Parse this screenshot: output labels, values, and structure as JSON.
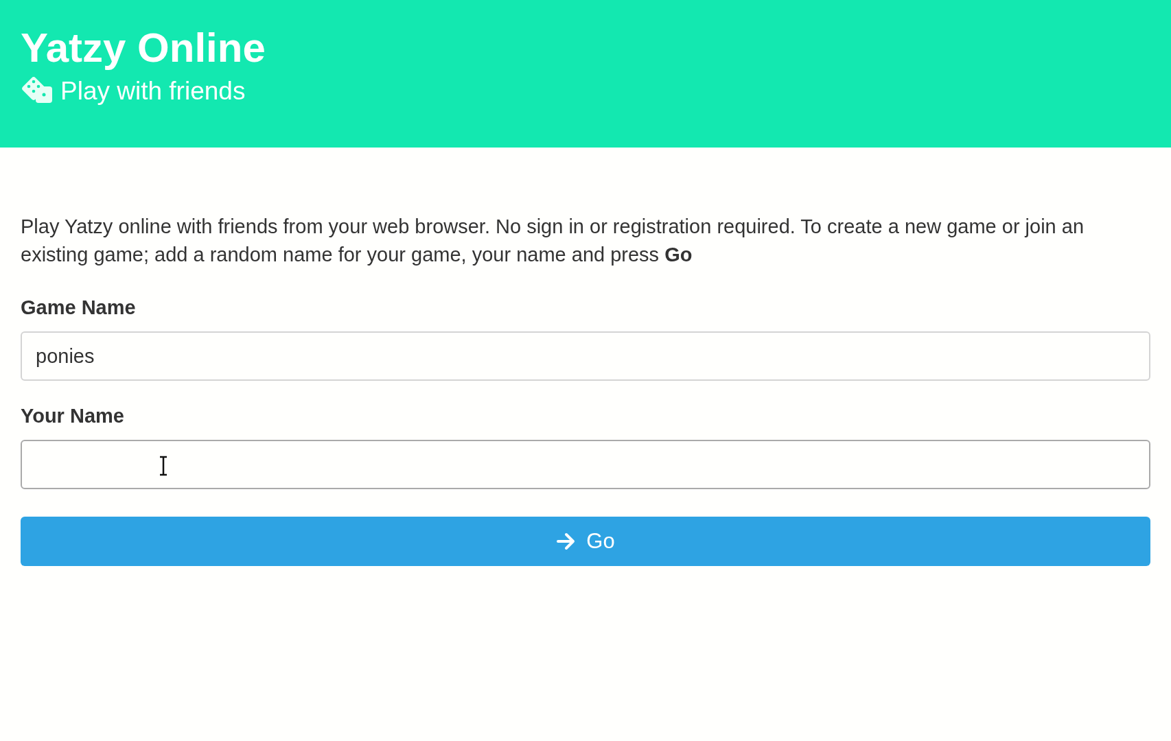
{
  "header": {
    "title": "Yatzy Online",
    "subtitle": "Play with friends"
  },
  "intro": "Play Yatzy online with friends from your web browser. No sign in or registration required. To create a new game or join an existing game; add a random name for your game, your name and press **Go**",
  "fields": [
    {
      "label": "Game Name",
      "value": "ponies"
    },
    {
      "label": "Your Name"
    }
  ],
  "button": {
    "label": "Go"
  }
}
